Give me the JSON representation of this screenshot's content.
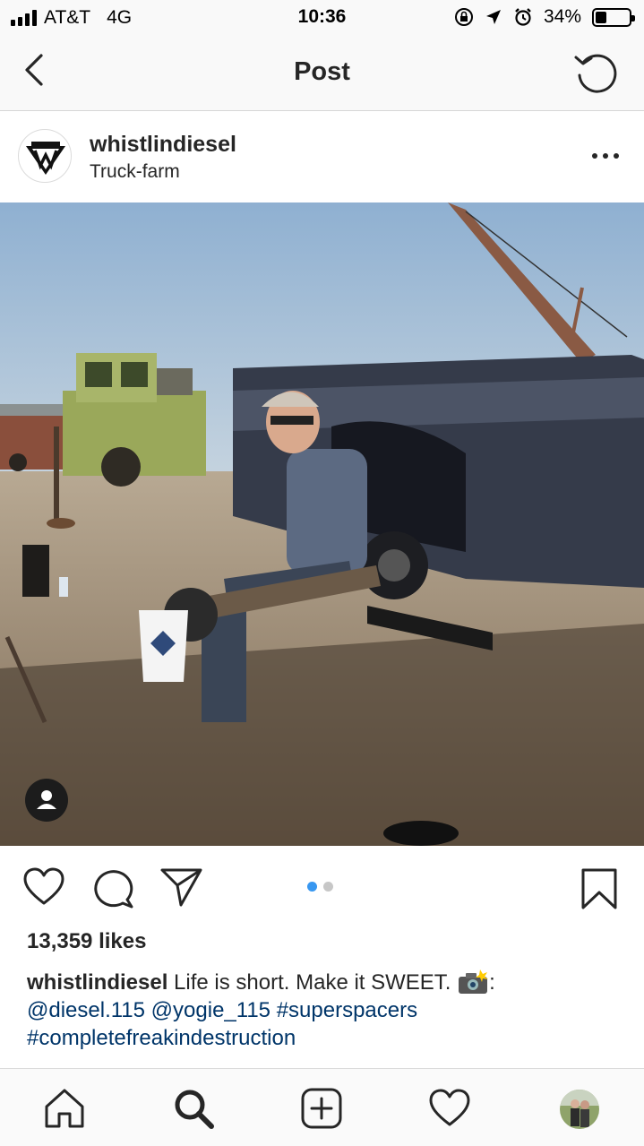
{
  "status_bar": {
    "carrier": "AT&T",
    "network": "4G",
    "time": "10:36",
    "battery": "34%",
    "battery_level": 0.34,
    "icons": [
      "signal-icon",
      "orientation-lock-icon",
      "location-arrow-icon",
      "alarm-icon",
      "battery-icon"
    ]
  },
  "nav": {
    "title": "Post",
    "back_icon": "chevron-left-icon",
    "refresh_icon": "refresh-icon"
  },
  "post": {
    "username": "whistlindiesel",
    "location": "Truck-farm",
    "more_icon": "ellipsis-icon",
    "carousel": {
      "count": 2,
      "active": 0
    },
    "tag_icon": "user-tag-icon",
    "likes": "13,359 likes",
    "caption": {
      "username": "whistlindiesel",
      "text": "Life is short. Make it SWEET.",
      "after_emoji": ":",
      "mentions": [
        "@diesel.115",
        "@yogie_115"
      ],
      "hashtags": [
        "#superspacers",
        "#completefreakindestruction"
      ]
    }
  },
  "actions": [
    "heart-icon",
    "comment-icon",
    "share-icon",
    "bookmark-icon"
  ],
  "tab_bar": [
    "home-icon",
    "search-icon",
    "add-icon",
    "activity-icon",
    "profile-avatar"
  ],
  "colors": {
    "link": "#003569",
    "active_dot": "#3897f0",
    "inactive_dot": "#c7c7c7"
  }
}
